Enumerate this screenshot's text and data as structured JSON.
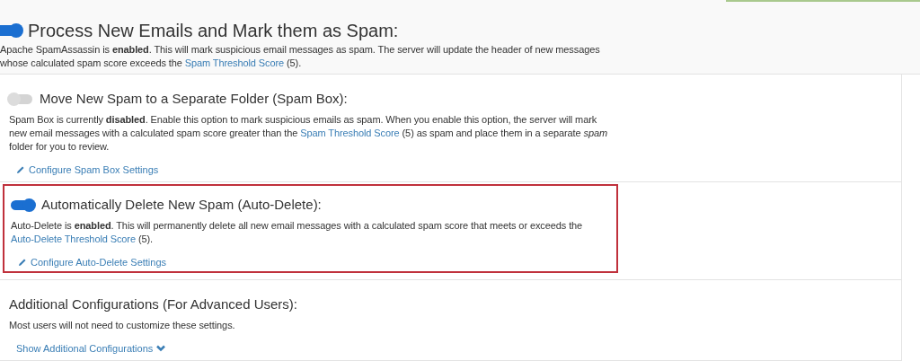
{
  "main": {
    "title": "Process New Emails and Mark them as Spam:",
    "on": true,
    "description": [
      {
        "kind": "text",
        "text": "Apache SpamAssassin is **enabled**. This will mark suspicious email messages as spam. The server will update the header of new messages whose calculated spam score exceeds the "
      },
      {
        "kind": "link",
        "text": "Spam Threshold Score"
      },
      {
        "kind": "text",
        "text": " (5)."
      }
    ]
  },
  "sections": [
    {
      "kind": "toggle",
      "title": "Move New Spam to a Separate Folder (Spam Box):",
      "on": false,
      "highlighted": false,
      "description": [
        {
          "kind": "text",
          "text": "Spam Box is currently **disabled**. Enable this option to mark suspicious emails as spam. When you enable this option, the server will mark new email messages with a calculated spam score greater than the "
        },
        {
          "kind": "link",
          "text": "Spam Threshold Score"
        },
        {
          "kind": "text",
          "text": " (5) as spam and place them in a separate *spam* folder for you to review."
        }
      ],
      "action": {
        "kind": "edit",
        "label": "Configure Spam Box Settings"
      }
    },
    {
      "kind": "toggle",
      "title": "Automatically Delete New Spam (Auto-Delete):",
      "on": true,
      "highlighted": true,
      "description": [
        {
          "kind": "text",
          "text": "Auto-Delete is **enabled**. This will permanently delete all new email messages with a calculated spam score that meets or exceeds the "
        },
        {
          "kind": "link",
          "text": "Auto-Delete Threshold Score"
        },
        {
          "kind": "text",
          "text": " (5)."
        }
      ],
      "action": {
        "kind": "edit",
        "label": "Configure Auto-Delete Settings"
      }
    },
    {
      "kind": "plain",
      "title": "Additional Configurations (For Advanced Users):",
      "highlighted": false,
      "description": [
        {
          "kind": "text",
          "text": "Most users will not need to customize these settings."
        }
      ],
      "action": {
        "kind": "expand",
        "label": "Show Additional Configurations"
      }
    }
  ]
}
